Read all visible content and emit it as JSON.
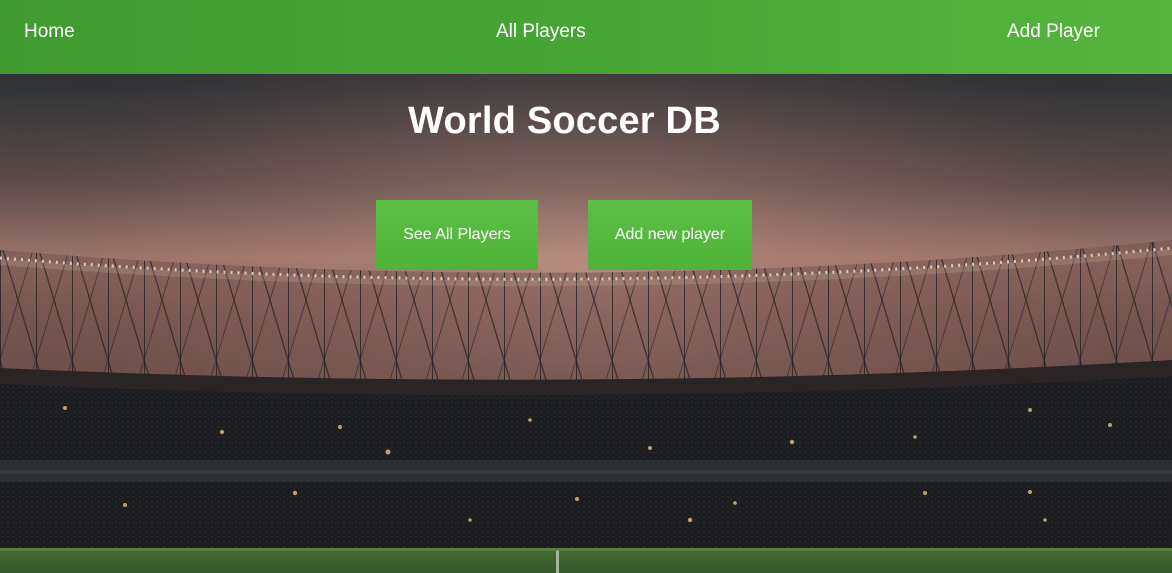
{
  "nav": {
    "home": "Home",
    "all_players": "All Players",
    "add_player": "Add Player"
  },
  "hero": {
    "title": "World Soccer DB",
    "see_all_button": "See All Players",
    "add_new_button": "Add new player"
  },
  "colors": {
    "nav_green": "#46a634",
    "button_green": "#56b940",
    "text": "#ffffff"
  }
}
